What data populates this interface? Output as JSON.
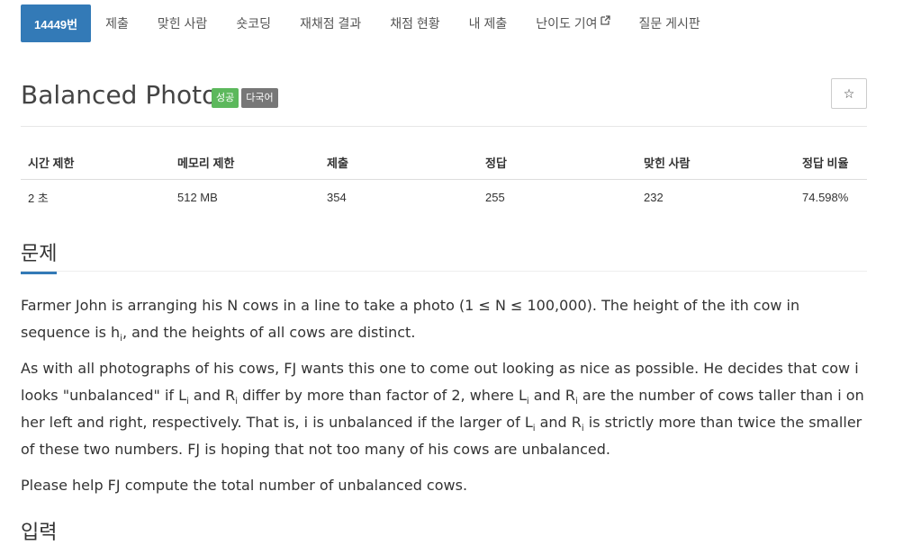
{
  "tabs": [
    {
      "label": "14449번",
      "active": true
    },
    {
      "label": "제출"
    },
    {
      "label": "맞힌 사람"
    },
    {
      "label": "숏코딩"
    },
    {
      "label": "재채점 결과"
    },
    {
      "label": "채점 현황"
    },
    {
      "label": "내 제출"
    },
    {
      "label": "난이도 기여",
      "external": true
    },
    {
      "label": "질문 게시판"
    }
  ],
  "problem": {
    "title": "Balanced Photo",
    "badges": {
      "success": "성공",
      "multilang": "다국어"
    },
    "star_icon": "☆"
  },
  "info_table": {
    "headers": [
      "시간 제한",
      "메모리 제한",
      "제출",
      "정답",
      "맞힌 사람",
      "정답 비율"
    ],
    "values": [
      "2 초",
      "512 MB",
      "354",
      "255",
      "232",
      "74.598%"
    ]
  },
  "sections": {
    "problem": "문제",
    "input": "입력"
  },
  "description": {
    "p1_a": "Farmer John is arranging his N cows in a line to take a photo (1 ≤ N ≤ 100,000). The height of the ith cow in sequence is h",
    "p1_sub": "i",
    "p1_b": ", and the heights of all cows are distinct.",
    "p2_a": "As with all photographs of his cows, FJ wants this one to come out looking as nice as possible. He decides that cow i looks \"unbalanced\" if L",
    "p2_b": " and R",
    "p2_c": " differ by more than factor of 2, where L",
    "p2_d": " and R",
    "p2_e": " are the number of cows taller than i on her left and right, respectively. That is, i is unbalanced if the larger of L",
    "p2_f": " and R",
    "p2_g": " is strictly more than twice the smaller of these two numbers. FJ is hoping that not too many of his cows are unbalanced.",
    "sub_i": "i",
    "p3": "Please help FJ compute the total number of unbalanced cows."
  },
  "colors": {
    "accent": "#337ab7",
    "success": "#5cb85c",
    "muted": "#777777"
  }
}
